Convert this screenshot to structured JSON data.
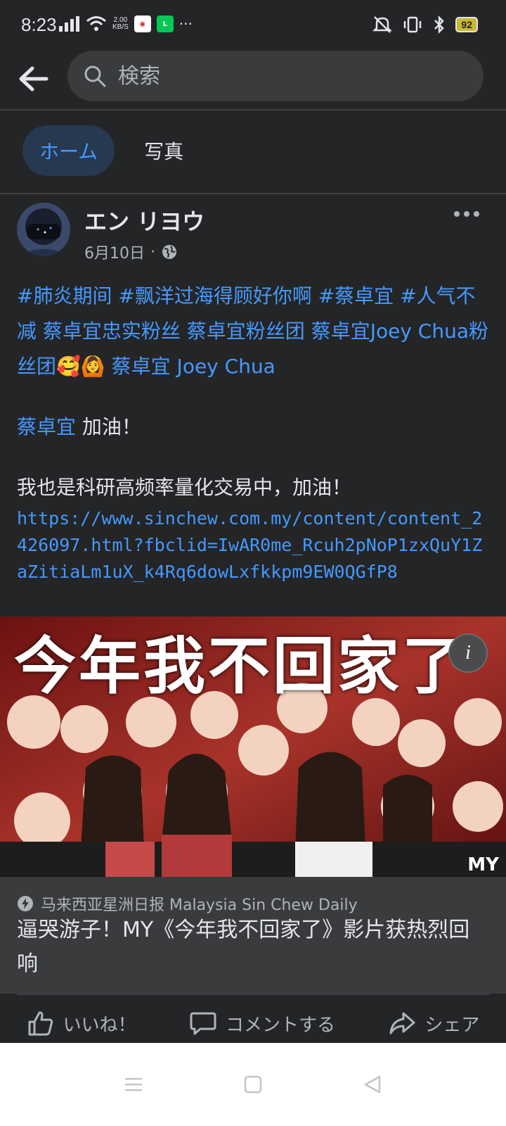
{
  "status_bar": {
    "time": "8:23",
    "net_speed_value": "2.00",
    "net_speed_unit": "KB/S",
    "battery": "92"
  },
  "search": {
    "placeholder": "検索"
  },
  "tabs": [
    {
      "label": "ホーム",
      "active": true
    },
    {
      "label": "写真",
      "active": false
    }
  ],
  "post": {
    "author": "エン リヨウ",
    "date": "6月10日",
    "separator": "·",
    "hashtags": "#肺炎期间 #飘洋过海得顾好你啊 #蔡卓宜 #人气不减 蔡卓宜忠实粉丝 蔡卓宜粉丝团 蔡卓宜Joey Chua粉丝团",
    "emojis": "🥰🙆",
    "tag_after_emojis": "蔡卓宜 Joey Chua",
    "line2_tag": "蔡卓宜",
    "line2_text": " 加油！",
    "line3_text": "我也是科研高频率量化交易中，加油！",
    "url": "https://www.sinchew.com.my/content/content_2426097.html?fbclid=IwAR0me_Rcuh2pNoP1zxQuY1ZaZitiaLm1uX_k4Rq6dowLxfkkpm9EW0QGfP8"
  },
  "media": {
    "banner_text": "今年我不回家了",
    "corner_text": "MY"
  },
  "link_card": {
    "source": "马来西亚星洲日报 Malaysia Sin Chew Daily",
    "headline": "逼哭游子！MY《今年我不回家了》影片获热烈回响"
  },
  "actions": {
    "like": "いいね！",
    "comment": "コメントする",
    "share": "シェア"
  },
  "colors": {
    "background": "#242526",
    "link": "#4599ff",
    "tab_active_bg": "#263951",
    "card_bg": "#3a3b3c"
  }
}
